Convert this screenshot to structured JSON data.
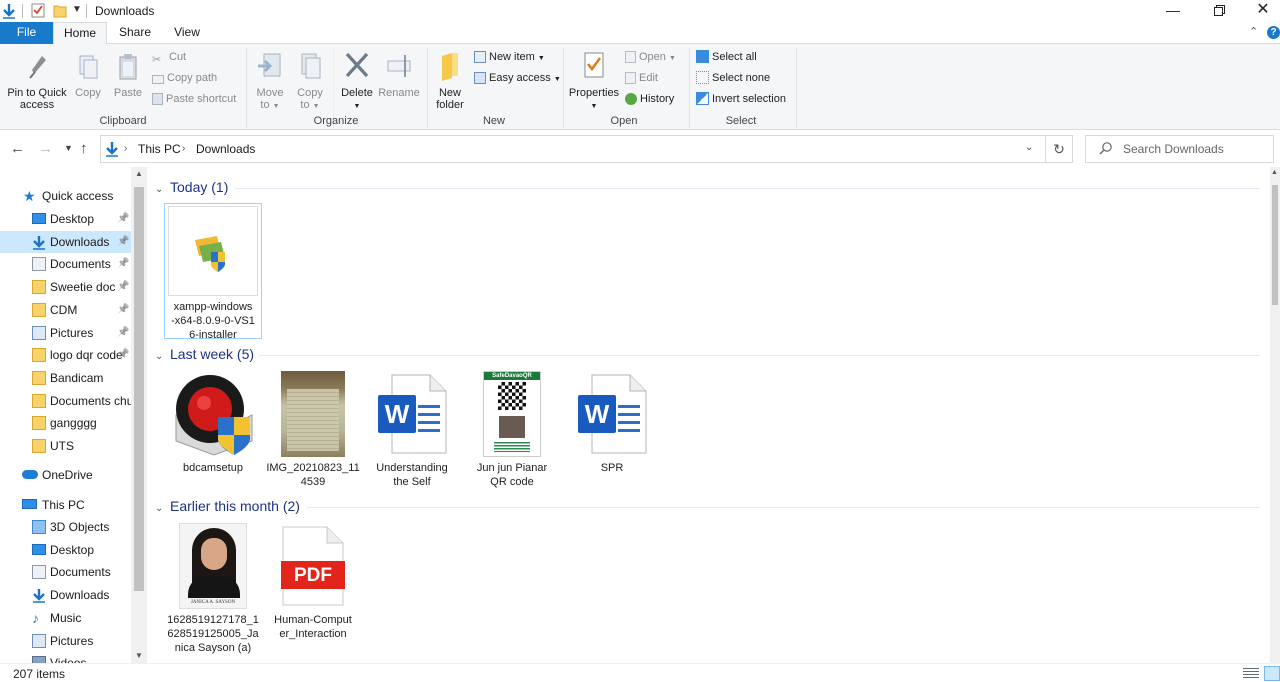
{
  "window": {
    "title": "Downloads"
  },
  "tabs": [
    {
      "label": "File"
    },
    {
      "label": "Home"
    },
    {
      "label": "Share"
    },
    {
      "label": "View"
    }
  ],
  "ribbon": {
    "clipboard": {
      "label": "Clipboard",
      "pin": "Pin to Quick access",
      "pin_l1": "Pin to Quick",
      "pin_l2": "access",
      "copy": "Copy",
      "paste": "Paste",
      "cut": "Cut",
      "copy_path": "Copy path",
      "paste_shortcut": "Paste shortcut"
    },
    "organize": {
      "label": "Organize",
      "move_to": "Move",
      "move_to2": "to",
      "copy_to": "Copy",
      "copy_to2": "to",
      "delete": "Delete",
      "rename": "Rename"
    },
    "new": {
      "label": "New",
      "new_folder1": "New",
      "new_folder2": "folder",
      "new_item": "New item",
      "easy_access": "Easy access"
    },
    "open": {
      "label": "Open",
      "properties": "Properties",
      "open": "Open",
      "edit": "Edit",
      "history": "History"
    },
    "select": {
      "label": "Select",
      "select_all": "Select all",
      "select_none": "Select none",
      "invert": "Invert selection"
    }
  },
  "address": {
    "crumbs": [
      "This PC",
      "Downloads"
    ],
    "search_placeholder": "Search Downloads"
  },
  "nav": {
    "quick_access": "Quick access",
    "quick_items": [
      {
        "label": "Desktop",
        "icon": "desktop-icon"
      },
      {
        "label": "Downloads",
        "icon": "download-icon"
      },
      {
        "label": "Documents",
        "icon": "document-icon"
      },
      {
        "label": "Sweetie doc",
        "icon": "folder-icon"
      },
      {
        "label": "CDM",
        "icon": "folder-icon"
      },
      {
        "label": "Pictures",
        "icon": "pictures-icon"
      },
      {
        "label": "logo dqr code",
        "icon": "folder-icon"
      },
      {
        "label": "Bandicam",
        "icon": "folder-icon"
      },
      {
        "label": "Documents chu",
        "icon": "folder-icon"
      },
      {
        "label": "gangggg",
        "icon": "folder-icon"
      },
      {
        "label": "UTS",
        "icon": "folder-icon"
      }
    ],
    "onedrive": "OneDrive",
    "this_pc": "This PC",
    "pc_items": [
      {
        "label": "3D Objects",
        "icon": "3d-objects-icon"
      },
      {
        "label": "Desktop",
        "icon": "desktop-icon"
      },
      {
        "label": "Documents",
        "icon": "document-icon"
      },
      {
        "label": "Downloads",
        "icon": "download-icon"
      },
      {
        "label": "Music",
        "icon": "music-icon"
      },
      {
        "label": "Pictures",
        "icon": "pictures-icon"
      },
      {
        "label": "Videos",
        "icon": "videos-icon"
      }
    ]
  },
  "groups": [
    {
      "header": "Today (1)",
      "files": [
        {
          "name": "xampp-windows-x64-8.0.9-0-VS16-installer",
          "l1": "xampp-windows",
          "l2": "-x64-8.0.9-0-VS1",
          "l3": "6-installer",
          "kind": "installer"
        }
      ]
    },
    {
      "header": "Last week (5)",
      "files": [
        {
          "name": "bdcamsetup",
          "l1": "bdcamsetup",
          "l2": "",
          "kind": "bandicam"
        },
        {
          "name": "IMG_20210823_114539",
          "l1": "IMG_20210823_11",
          "l2": "4539",
          "kind": "photo"
        },
        {
          "name": "Understanding the Self",
          "l1": "Understanding",
          "l2": "the Self",
          "kind": "word"
        },
        {
          "name": "Jun jun Pianar QR code",
          "l1": "Jun jun Pianar",
          "l2": "QR code",
          "kind": "qr",
          "qr_header": "SafeDavaoQR"
        },
        {
          "name": "SPR",
          "l1": "SPR",
          "l2": "",
          "kind": "word"
        }
      ]
    },
    {
      "header": "Earlier this month (2)",
      "files": [
        {
          "name": "1628519127178_1628519125005_Janica Sayson (a)",
          "l1": "1628519127178_1",
          "l2": "628519125005_Ja",
          "l3": "nica Sayson (a)",
          "kind": "portrait",
          "caption": "JANICA A. SAYSON"
        },
        {
          "name": "Human-Computer_Interaction",
          "l1": "Human-Comput",
          "l2": "er_Interaction",
          "kind": "pdf",
          "badge": "PDF"
        }
      ]
    }
  ],
  "status": {
    "count": "207 items"
  },
  "colors": {
    "accent": "#1979ca",
    "selection": "#cce8ff",
    "group_header": "#1e3287"
  }
}
